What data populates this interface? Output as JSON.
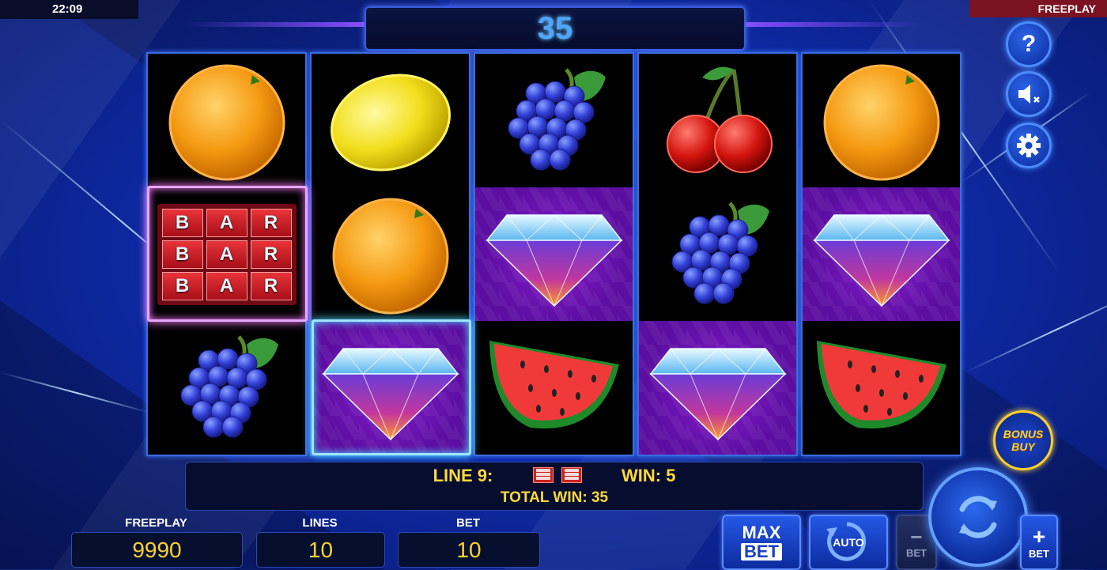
{
  "status": {
    "time": "22:09",
    "mode": "FREEPLAY"
  },
  "top_win": "35",
  "reels": [
    [
      "orange",
      "bar",
      "grapes"
    ],
    [
      "lemon",
      "orange",
      "diamond"
    ],
    [
      "grapes",
      "diamond",
      "watermelon"
    ],
    [
      "cherries",
      "grapes",
      "diamond"
    ],
    [
      "orange",
      "diamond",
      "watermelon"
    ]
  ],
  "bar_symbol": {
    "text": "BAR"
  },
  "side_buttons": {
    "help": "?",
    "sound_icon": "speaker-muted-icon",
    "settings_icon": "gear-icon"
  },
  "bonus_buy": {
    "line1": "BONUS",
    "line2": "BUY"
  },
  "win_info": {
    "line_label": "LINE 9:",
    "win_label": "WIN: 5",
    "total_label": "TOTAL WIN: 35"
  },
  "bottom": {
    "freeplay_label": "FREEPLAY",
    "freeplay_value": "9990",
    "lines_label": "LINES",
    "lines_value": "10",
    "bet_label": "BET",
    "bet_value": "10"
  },
  "buttons": {
    "max_bet_line1": "MAX",
    "max_bet_line2": "BET",
    "auto": "AUTO",
    "bet_minus_sign": "−",
    "bet_minus_label": "BET",
    "bet_plus_sign": "+",
    "bet_plus_label": "BET"
  },
  "colors": {
    "accent_gold": "#ffd93a",
    "win_blue": "#4fa6ff",
    "highlight_pink": "#ff7bff",
    "highlight_cyan": "#4de0ff"
  }
}
